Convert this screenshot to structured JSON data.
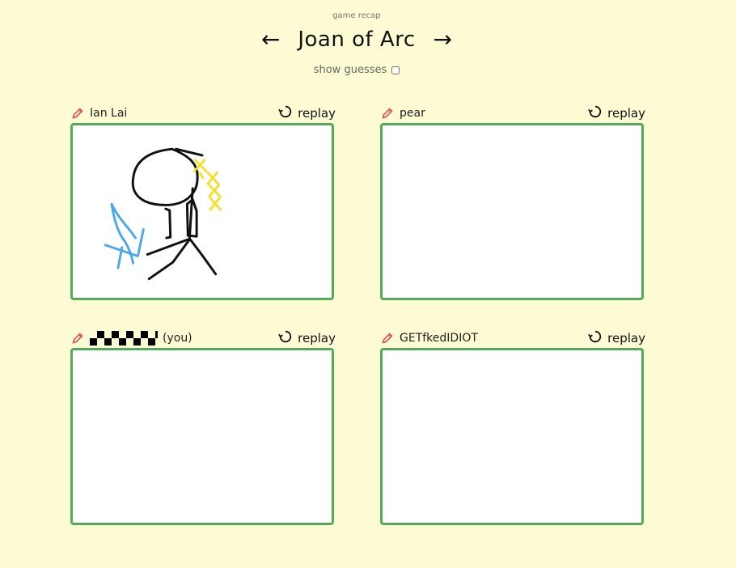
{
  "header": {
    "subtitle": "game recap",
    "title": "Joan of Arc",
    "prev_arrow": "←",
    "next_arrow": "→",
    "show_guesses_label": "show guesses"
  },
  "cards": [
    {
      "player": "Ian Lai",
      "replay_label": "replay"
    },
    {
      "player": "pear",
      "replay_label": "replay"
    },
    {
      "player_suffix": "(you)",
      "replay_label": "replay"
    },
    {
      "player": "GETfkedIDIOT",
      "replay_label": "replay"
    }
  ],
  "colors": {
    "background": "#fdfbd3",
    "border": "#54a95b",
    "pencil": "#e05b5b",
    "stroke_black": "#111111",
    "stroke_blue": "#4ea8e8",
    "stroke_yellow": "#f3e12f"
  },
  "icons": {
    "player_icon": "pencil-icon",
    "replay_icon": "replay-icon"
  }
}
